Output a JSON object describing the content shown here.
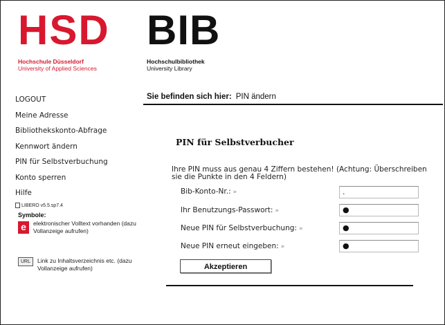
{
  "header": {
    "hsd_logo": "HSD",
    "hsd_name_line1": "Hochschule Düsseldorf",
    "hsd_name_line2": "University of Applied Sciences",
    "bib_logo": "BIB",
    "bib_name_line1": "Hochschulbibliothek",
    "bib_name_line2": "University Library"
  },
  "sidebar": {
    "items": [
      {
        "label": "LOGOUT"
      },
      {
        "label": "Meine Adresse"
      },
      {
        "label": "Bibliothekskonto-Abfrage"
      },
      {
        "label": "Kennwort ändern"
      },
      {
        "label": "PIN für Selbstverbuchung"
      },
      {
        "label": "Konto sperren"
      },
      {
        "label": "Hilfe"
      }
    ],
    "version": "LIBERO v5.5.sp7.4",
    "symbols_heading": "Symbole:",
    "symbols": [
      {
        "badge": "e",
        "text": "elektronischer Volltext vorhanden (dazu Vollanzeige aufrufen)",
        "icon": "e-volltext-icon"
      },
      {
        "badge": "URL",
        "text": "Link zu Inhaltsverzeichnis etc. (dazu Vollanzeige aufrufen)",
        "icon": "url-link-icon"
      }
    ]
  },
  "breadcrumb": {
    "prefix": "Sie befinden sich hier:",
    "current": "PIN ändern"
  },
  "form": {
    "title": "PIN für Selbstverbucher",
    "intro": "Ihre PIN muss aus genau 4 Ziffern bestehen! (Achtung: Überschreiben sie die Punkte in den 4 Feldern)",
    "fields": [
      {
        "label": "Bib-Konto-Nr.:",
        "value": "."
      },
      {
        "label": "Ihr Benutzungs-Passwort:",
        "value": "●"
      },
      {
        "label": "Neue PIN für Selbstverbuchung:",
        "value": "●"
      },
      {
        "label": "Neue PIN erneut eingeben:",
        "value": "●"
      }
    ],
    "label_marker": "»",
    "submit_label": "Akzeptieren"
  },
  "colors": {
    "brand_red": "#d8182f",
    "text": "#222222"
  }
}
